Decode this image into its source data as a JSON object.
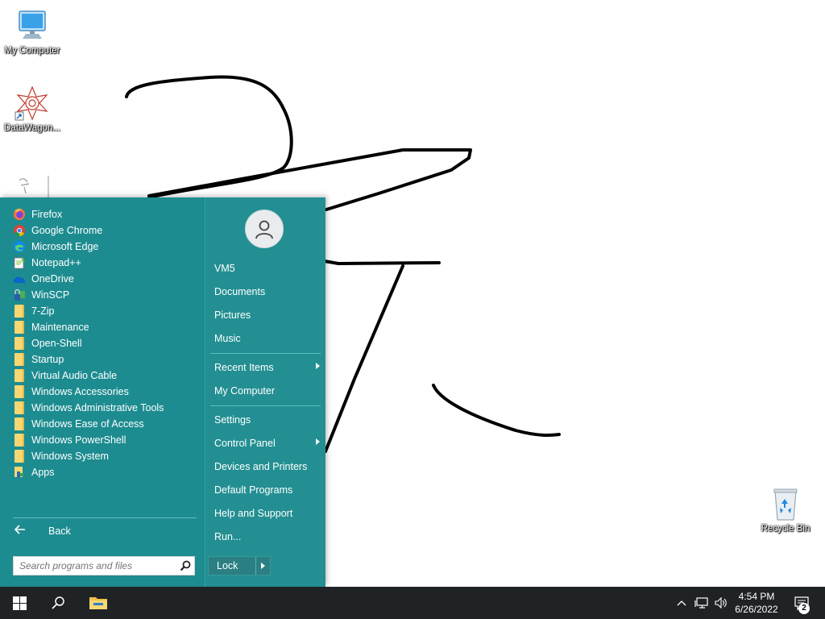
{
  "desktop": {
    "icons": [
      {
        "label": "My Computer",
        "icon": "computer-monitor-icon"
      },
      {
        "label": "DataWagon...",
        "icon": "datawagon-logo-icon"
      },
      {
        "label": "Recycle Bin",
        "icon": "recycle-bin-icon"
      }
    ]
  },
  "start_menu": {
    "programs": [
      {
        "label": "Firefox",
        "icon": "firefox-icon"
      },
      {
        "label": "Google Chrome",
        "icon": "chrome-icon"
      },
      {
        "label": "Microsoft Edge",
        "icon": "edge-icon"
      },
      {
        "label": "Notepad++",
        "icon": "notepadpp-icon"
      },
      {
        "label": "OneDrive",
        "icon": "onedrive-icon"
      },
      {
        "label": "WinSCP",
        "icon": "winscp-icon"
      },
      {
        "label": "7-Zip",
        "icon": "folder-icon"
      },
      {
        "label": "Maintenance",
        "icon": "folder-icon"
      },
      {
        "label": "Open-Shell",
        "icon": "folder-icon"
      },
      {
        "label": "Startup",
        "icon": "folder-icon"
      },
      {
        "label": "Virtual Audio Cable",
        "icon": "folder-icon"
      },
      {
        "label": "Windows Accessories",
        "icon": "folder-icon"
      },
      {
        "label": "Windows Administrative Tools",
        "icon": "folder-icon"
      },
      {
        "label": "Windows Ease of Access",
        "icon": "folder-icon"
      },
      {
        "label": "Windows PowerShell",
        "icon": "folder-icon"
      },
      {
        "label": "Windows System",
        "icon": "folder-icon"
      },
      {
        "label": "Apps",
        "icon": "apps-icon"
      }
    ],
    "back_label": "Back",
    "search_placeholder": "Search programs and files",
    "right_items": {
      "user": "VM5",
      "documents": "Documents",
      "pictures": "Pictures",
      "music": "Music",
      "recent_items": "Recent Items",
      "my_computer": "My Computer",
      "settings": "Settings",
      "control_panel": "Control Panel",
      "devices_printers": "Devices and Printers",
      "default_programs": "Default Programs",
      "help_support": "Help and Support",
      "run": "Run..."
    },
    "lock_label": "Lock",
    "colors": {
      "menu_bg": "#1d8c90",
      "folder": "#f7d774"
    }
  },
  "taskbar": {
    "time": "4:54 PM",
    "date": "6/26/2022",
    "notification_count": "2"
  }
}
